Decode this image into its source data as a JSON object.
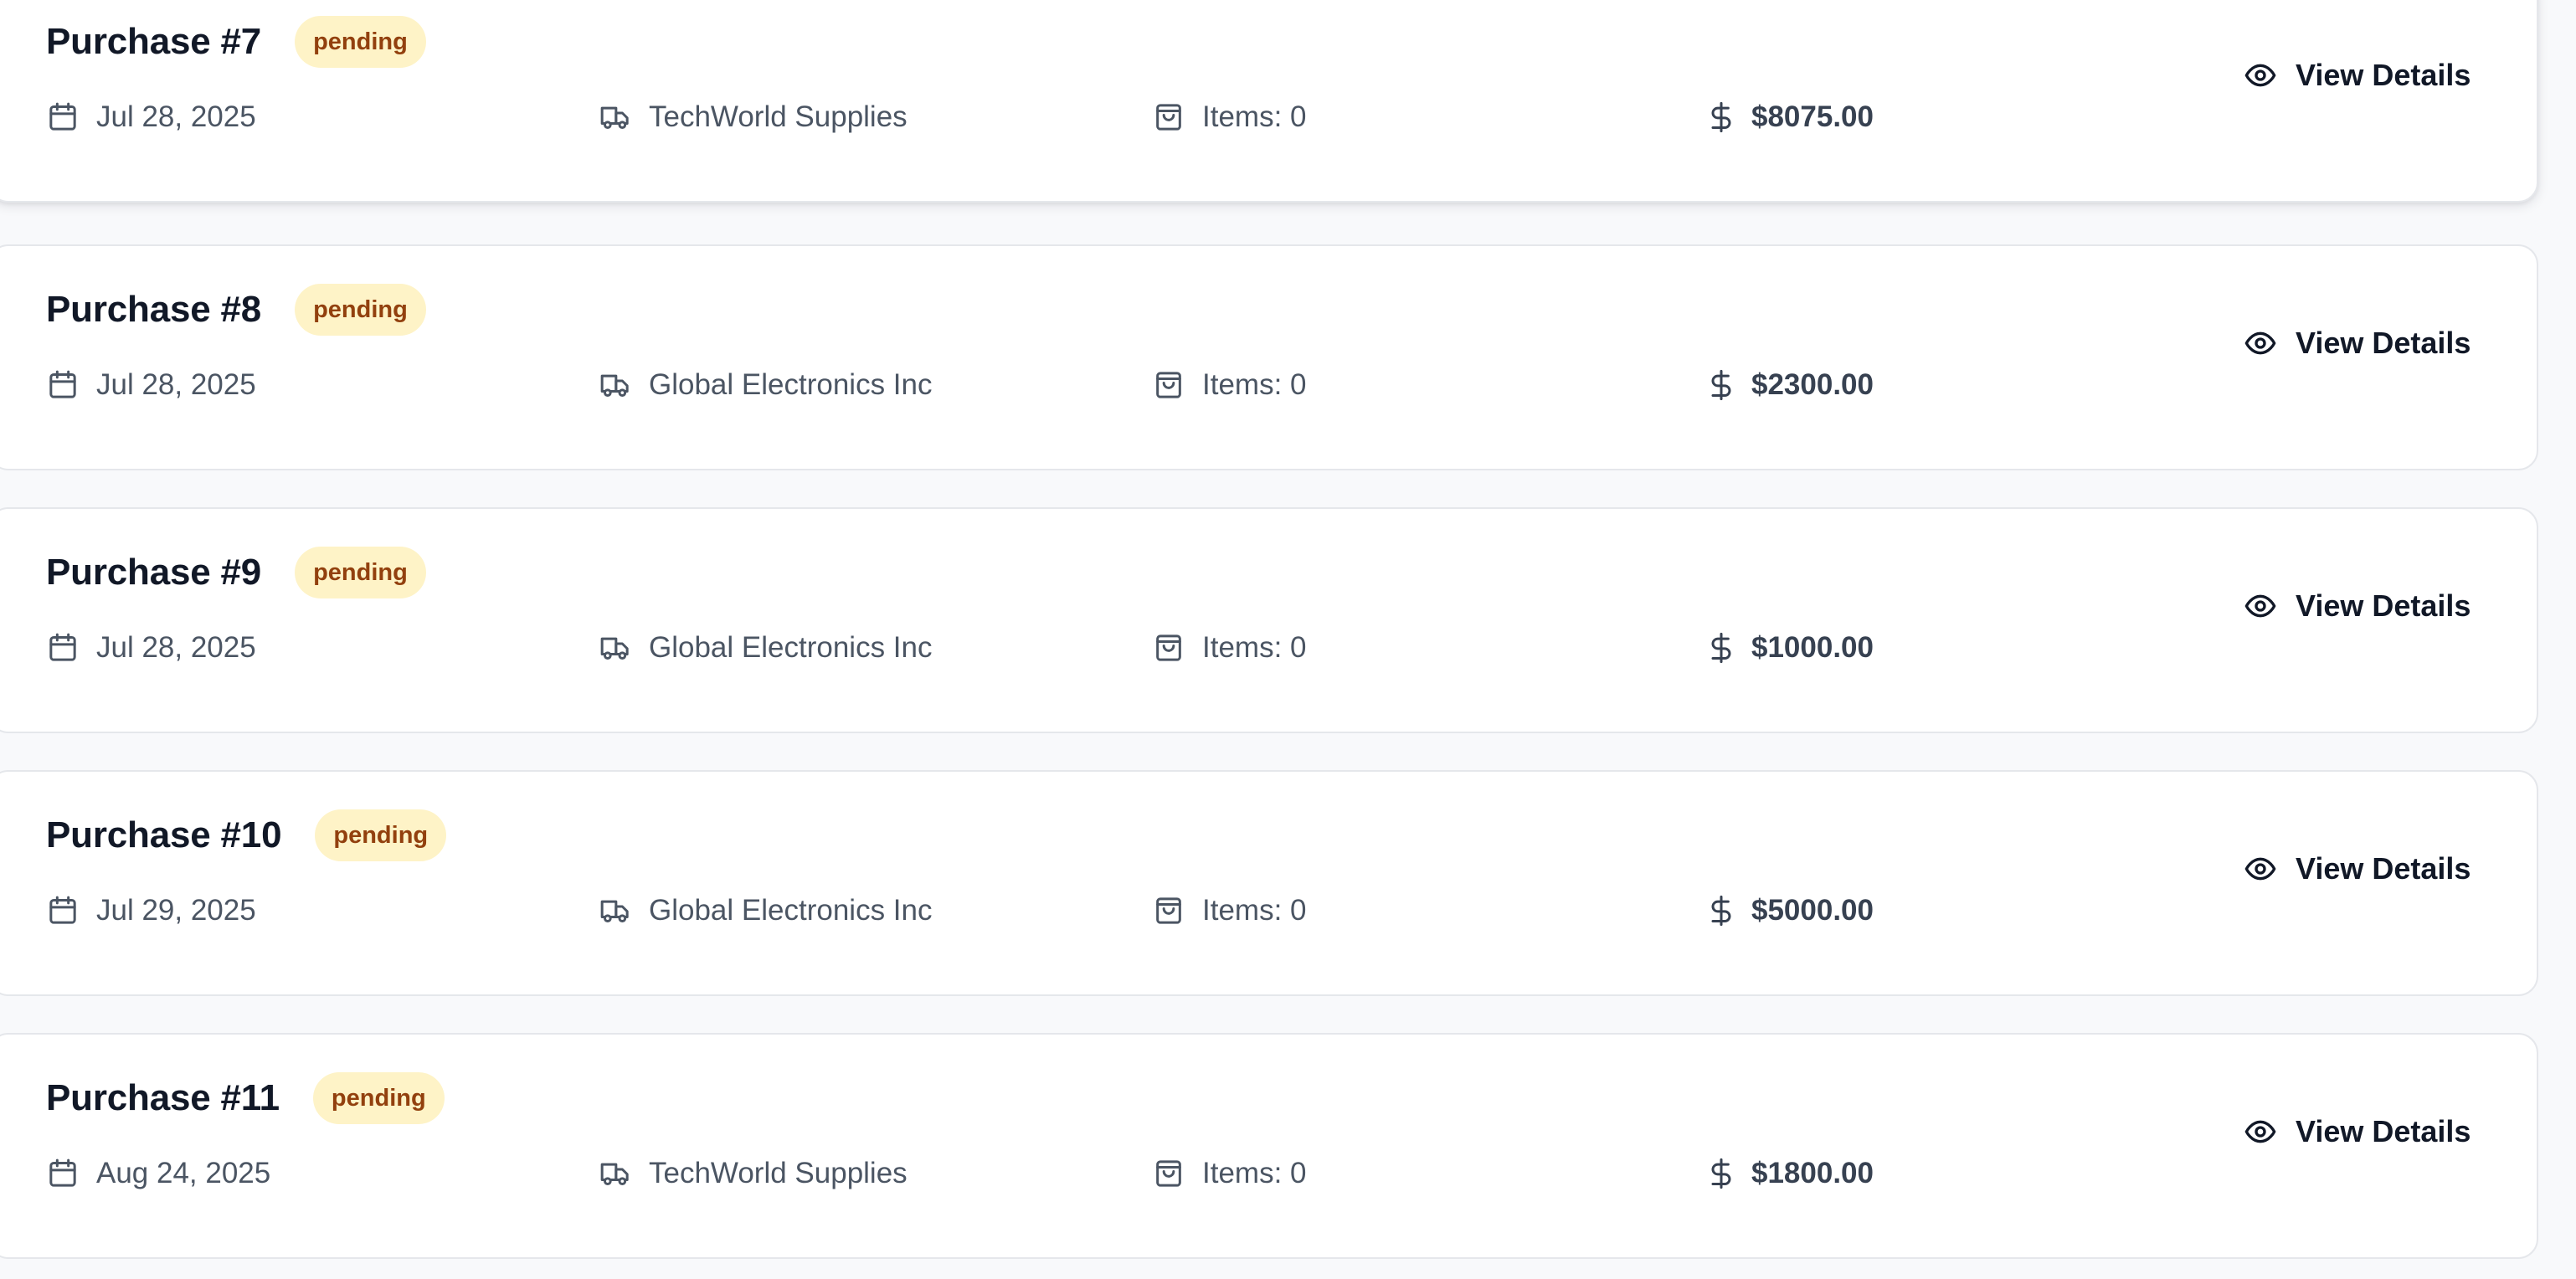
{
  "purchases": [
    {
      "title": "Purchase #7",
      "status": "pending",
      "date": "Jul 28, 2025",
      "vendor": "TechWorld Supplies",
      "items": "Items: 0",
      "total": "$8075.00",
      "action": "View Details"
    },
    {
      "title": "Purchase #8",
      "status": "pending",
      "date": "Jul 28, 2025",
      "vendor": "Global Electronics Inc",
      "items": "Items: 0",
      "total": "$2300.00",
      "action": "View Details"
    },
    {
      "title": "Purchase #9",
      "status": "pending",
      "date": "Jul 28, 2025",
      "vendor": "Global Electronics Inc",
      "items": "Items: 0",
      "total": "$1000.00",
      "action": "View Details"
    },
    {
      "title": "Purchase #10",
      "status": "pending",
      "date": "Jul 29, 2025",
      "vendor": "Global Electronics Inc",
      "items": "Items: 0",
      "total": "$5000.00",
      "action": "View Details"
    },
    {
      "title": "Purchase #11",
      "status": "pending",
      "date": "Aug 24, 2025",
      "vendor": "TechWorld Supplies",
      "items": "Items: 0",
      "total": "$1800.00",
      "action": "View Details"
    }
  ],
  "icons": {
    "date": "calendar-icon",
    "vendor": "truck-icon",
    "items": "shopping-bag-icon",
    "total": "dollar-icon",
    "action": "eye-icon"
  },
  "colors": {
    "badge_bg": "#fef3c7",
    "badge_text": "#92400e",
    "card_bg": "#ffffff",
    "page_bg": "#f8f9fb"
  }
}
